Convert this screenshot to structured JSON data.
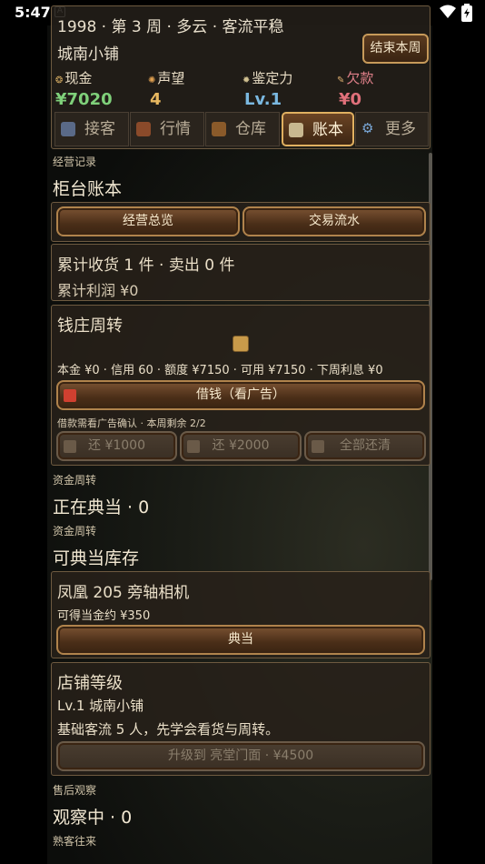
{
  "status_bar": {
    "time": "5:47"
  },
  "header": {
    "info_line": "1998 · 第 3 周 · 多云 · 客流平稳",
    "shop_name": "城南小铺",
    "end_week_label": "结束本周",
    "stats": [
      {
        "label": "现金",
        "value": "¥7020",
        "color": "#7fd07a"
      },
      {
        "label": "声望",
        "value": "4",
        "color": "#e8b860"
      },
      {
        "label": "鉴定力",
        "value": "Lv.1",
        "color": "#7ab8e0"
      },
      {
        "label": "欠款",
        "value": "¥0",
        "color": "#e0707a"
      }
    ]
  },
  "tabs": [
    {
      "label": "接客",
      "icon": "person-icon",
      "active": false
    },
    {
      "label": "行情",
      "icon": "market-icon",
      "active": false
    },
    {
      "label": "仓库",
      "icon": "warehouse-icon",
      "active": false
    },
    {
      "label": "账本",
      "icon": "ledger-icon",
      "active": true
    },
    {
      "label": "更多",
      "icon": "gear-icon",
      "active": false
    }
  ],
  "ledger": {
    "section_label": "经营记录",
    "title": "柜台账本",
    "overview_label": "经营总览",
    "flow_label": "交易流水",
    "summary_line1": "累计收货 1 件 · 卖出 0 件",
    "summary_line2": "累计利润 ¥0"
  },
  "bank": {
    "title": "钱庄周转",
    "info": "本金 ¥0 · 信用 60 · 额度 ¥7150 · 可用 ¥7150 · 下周利息 ¥0",
    "borrow_label": "借钱（看广告）",
    "note": "借款需看广告确认 · 本周剩余 2/2",
    "repay1_label": "还 ¥1000",
    "repay2_label": "还 ¥2000",
    "repay_all_label": "全部还清"
  },
  "pawn": {
    "section_label_1": "资金周转",
    "pawning_title": "正在典当 · 0",
    "section_label_2": "资金周转",
    "pawnable_title": "可典当库存",
    "item_name": "凤凰 205 旁轴相机",
    "item_value": "可得当金约 ¥350",
    "pawn_label": "典当"
  },
  "shop_level": {
    "title": "店铺等级",
    "level_line": "Lv.1 城南小铺",
    "desc": "基础客流 5 人，先学会看货与周转。",
    "upgrade_label": "升级到 亮堂门面 · ¥4500"
  },
  "after_sales": {
    "section_label": "售后观察",
    "title": "观察中 · 0",
    "next_label": "熟客往来"
  }
}
